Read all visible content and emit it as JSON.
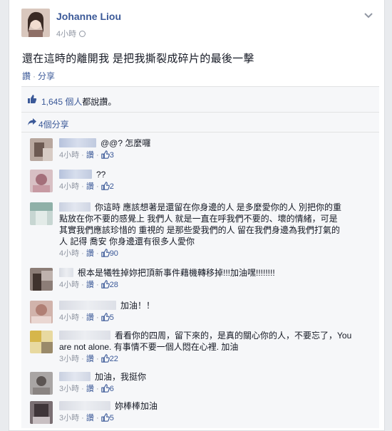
{
  "post": {
    "author": "Johanne Liou",
    "time": "4小時",
    "text": "還在這時的離開我 是把我撕裂成碎片的最後一擊",
    "actions": {
      "like": "讚",
      "share": "分享",
      "separator": "·"
    },
    "likes": {
      "count": "1,645 個人",
      "suffix": "都說讚。"
    },
    "shares": "4個分享"
  },
  "comments": [
    {
      "text": "@@? 怎麼囉",
      "time": "4小時",
      "like": "讚",
      "count": "3"
    },
    {
      "text": "??",
      "time": "4小時",
      "like": "讚",
      "count": "2"
    },
    {
      "text": "你這時 應該想著是還留在你身邊的人 是多麼愛你的人 別把你的重",
      "text2": "點放在你不要的感覺上 我們人 就是一直在呼我們不要的、壞的情緒，可是",
      "text3": "其實我們應該珍惜的 重視的 是那些愛我們的人 留在我們身邊為我們打氣的",
      "text4": "人 記得 喬安 你身邊還有很多人愛你",
      "time": "4小時",
      "like": "讚",
      "count": "90"
    },
    {
      "text": "根本是犧牲掉妳把頂新事件藉機轉移掉!!!加油嘿!!!!!!!!",
      "time": "4小時",
      "like": "讚",
      "count": "28"
    },
    {
      "text": "加油！！",
      "time": "4小時",
      "like": "讚",
      "count": "5"
    },
    {
      "text": "看看你的四周，留下來的，是真的關心你的人，不要忘了，You",
      "text2": "are not alone. 有事情不要一個人悶在心裡. 加油",
      "time": "3小時",
      "like": "讚",
      "count": "22"
    },
    {
      "text": "加油，我挺你",
      "time": "3小時",
      "like": "讚",
      "count": "6"
    },
    {
      "text": "妳棒棒加油",
      "time": "3小時",
      "like": "讚",
      "count": "5"
    }
  ],
  "icons": {
    "chevron": "chevron-down-icon",
    "thumb": "thumbs-up-icon",
    "share": "share-arrow-icon",
    "globe": "globe-icon"
  },
  "colors": {
    "link": "#3b5998",
    "meta": "#9197a3",
    "ufi_bg": "#f6f7f9"
  }
}
